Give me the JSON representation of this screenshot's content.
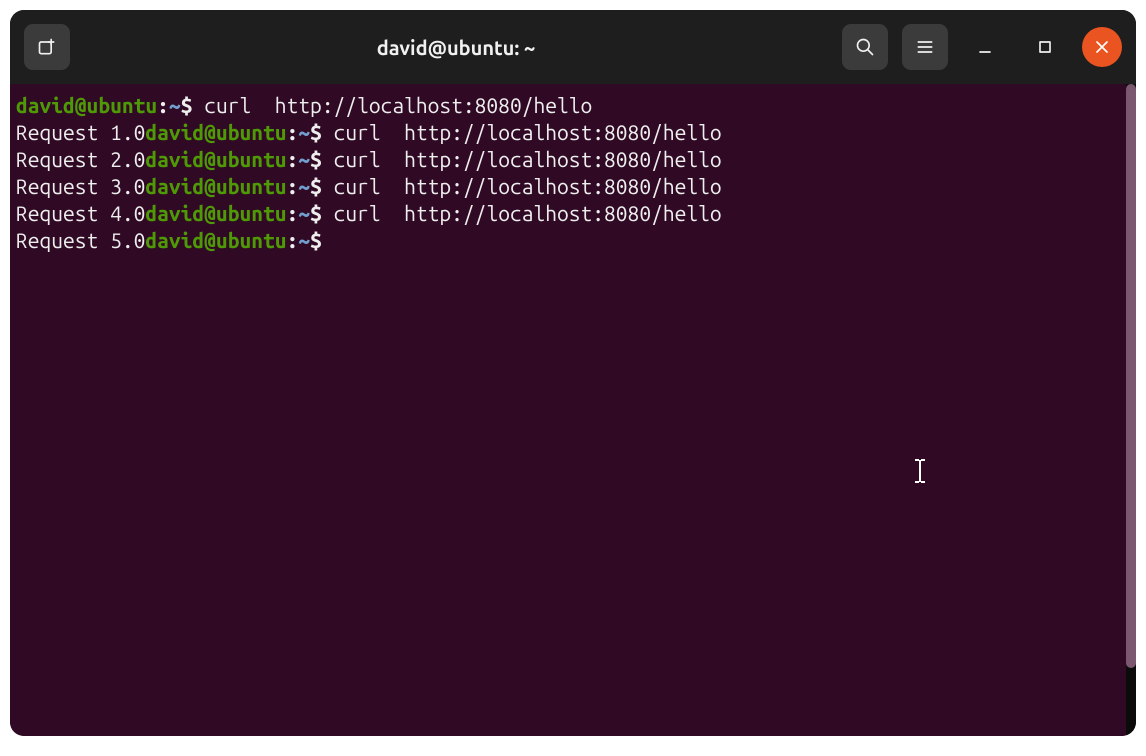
{
  "title": "david@ubuntu: ~",
  "prompt": {
    "user_host": "david@ubuntu",
    "sep1": ":",
    "path": "~",
    "sep2": "$"
  },
  "command": "curl  http://localhost:8080/hello",
  "outputs": [
    "Request 1.0",
    "Request 2.0",
    "Request 3.0",
    "Request 4.0",
    "Request 5.0"
  ],
  "colors": {
    "term_bg": "#300a24",
    "user_green": "#4e9a06",
    "path_blue": "#729fcf",
    "close_orange": "#e95420"
  }
}
